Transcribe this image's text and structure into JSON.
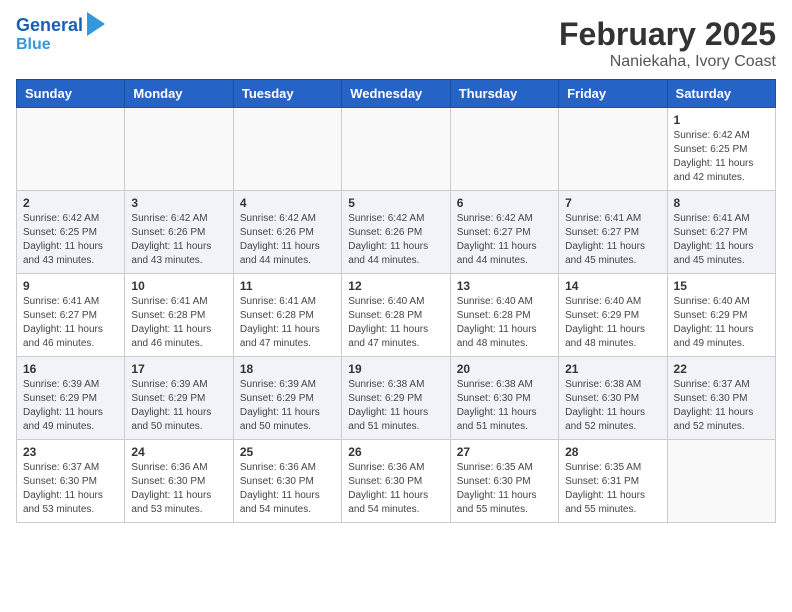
{
  "header": {
    "logo_line1": "General",
    "logo_line2": "Blue",
    "title": "February 2025",
    "subtitle": "Naniekaha, Ivory Coast"
  },
  "days_of_week": [
    "Sunday",
    "Monday",
    "Tuesday",
    "Wednesday",
    "Thursday",
    "Friday",
    "Saturday"
  ],
  "weeks": [
    [
      {
        "day": "",
        "info": ""
      },
      {
        "day": "",
        "info": ""
      },
      {
        "day": "",
        "info": ""
      },
      {
        "day": "",
        "info": ""
      },
      {
        "day": "",
        "info": ""
      },
      {
        "day": "",
        "info": ""
      },
      {
        "day": "1",
        "info": "Sunrise: 6:42 AM\nSunset: 6:25 PM\nDaylight: 11 hours and 42 minutes."
      }
    ],
    [
      {
        "day": "2",
        "info": "Sunrise: 6:42 AM\nSunset: 6:25 PM\nDaylight: 11 hours and 43 minutes."
      },
      {
        "day": "3",
        "info": "Sunrise: 6:42 AM\nSunset: 6:26 PM\nDaylight: 11 hours and 43 minutes."
      },
      {
        "day": "4",
        "info": "Sunrise: 6:42 AM\nSunset: 6:26 PM\nDaylight: 11 hours and 44 minutes."
      },
      {
        "day": "5",
        "info": "Sunrise: 6:42 AM\nSunset: 6:26 PM\nDaylight: 11 hours and 44 minutes."
      },
      {
        "day": "6",
        "info": "Sunrise: 6:42 AM\nSunset: 6:27 PM\nDaylight: 11 hours and 44 minutes."
      },
      {
        "day": "7",
        "info": "Sunrise: 6:41 AM\nSunset: 6:27 PM\nDaylight: 11 hours and 45 minutes."
      },
      {
        "day": "8",
        "info": "Sunrise: 6:41 AM\nSunset: 6:27 PM\nDaylight: 11 hours and 45 minutes."
      }
    ],
    [
      {
        "day": "9",
        "info": "Sunrise: 6:41 AM\nSunset: 6:27 PM\nDaylight: 11 hours and 46 minutes."
      },
      {
        "day": "10",
        "info": "Sunrise: 6:41 AM\nSunset: 6:28 PM\nDaylight: 11 hours and 46 minutes."
      },
      {
        "day": "11",
        "info": "Sunrise: 6:41 AM\nSunset: 6:28 PM\nDaylight: 11 hours and 47 minutes."
      },
      {
        "day": "12",
        "info": "Sunrise: 6:40 AM\nSunset: 6:28 PM\nDaylight: 11 hours and 47 minutes."
      },
      {
        "day": "13",
        "info": "Sunrise: 6:40 AM\nSunset: 6:28 PM\nDaylight: 11 hours and 48 minutes."
      },
      {
        "day": "14",
        "info": "Sunrise: 6:40 AM\nSunset: 6:29 PM\nDaylight: 11 hours and 48 minutes."
      },
      {
        "day": "15",
        "info": "Sunrise: 6:40 AM\nSunset: 6:29 PM\nDaylight: 11 hours and 49 minutes."
      }
    ],
    [
      {
        "day": "16",
        "info": "Sunrise: 6:39 AM\nSunset: 6:29 PM\nDaylight: 11 hours and 49 minutes."
      },
      {
        "day": "17",
        "info": "Sunrise: 6:39 AM\nSunset: 6:29 PM\nDaylight: 11 hours and 50 minutes."
      },
      {
        "day": "18",
        "info": "Sunrise: 6:39 AM\nSunset: 6:29 PM\nDaylight: 11 hours and 50 minutes."
      },
      {
        "day": "19",
        "info": "Sunrise: 6:38 AM\nSunset: 6:29 PM\nDaylight: 11 hours and 51 minutes."
      },
      {
        "day": "20",
        "info": "Sunrise: 6:38 AM\nSunset: 6:30 PM\nDaylight: 11 hours and 51 minutes."
      },
      {
        "day": "21",
        "info": "Sunrise: 6:38 AM\nSunset: 6:30 PM\nDaylight: 11 hours and 52 minutes."
      },
      {
        "day": "22",
        "info": "Sunrise: 6:37 AM\nSunset: 6:30 PM\nDaylight: 11 hours and 52 minutes."
      }
    ],
    [
      {
        "day": "23",
        "info": "Sunrise: 6:37 AM\nSunset: 6:30 PM\nDaylight: 11 hours and 53 minutes."
      },
      {
        "day": "24",
        "info": "Sunrise: 6:36 AM\nSunset: 6:30 PM\nDaylight: 11 hours and 53 minutes."
      },
      {
        "day": "25",
        "info": "Sunrise: 6:36 AM\nSunset: 6:30 PM\nDaylight: 11 hours and 54 minutes."
      },
      {
        "day": "26",
        "info": "Sunrise: 6:36 AM\nSunset: 6:30 PM\nDaylight: 11 hours and 54 minutes."
      },
      {
        "day": "27",
        "info": "Sunrise: 6:35 AM\nSunset: 6:30 PM\nDaylight: 11 hours and 55 minutes."
      },
      {
        "day": "28",
        "info": "Sunrise: 6:35 AM\nSunset: 6:31 PM\nDaylight: 11 hours and 55 minutes."
      },
      {
        "day": "",
        "info": ""
      }
    ]
  ]
}
